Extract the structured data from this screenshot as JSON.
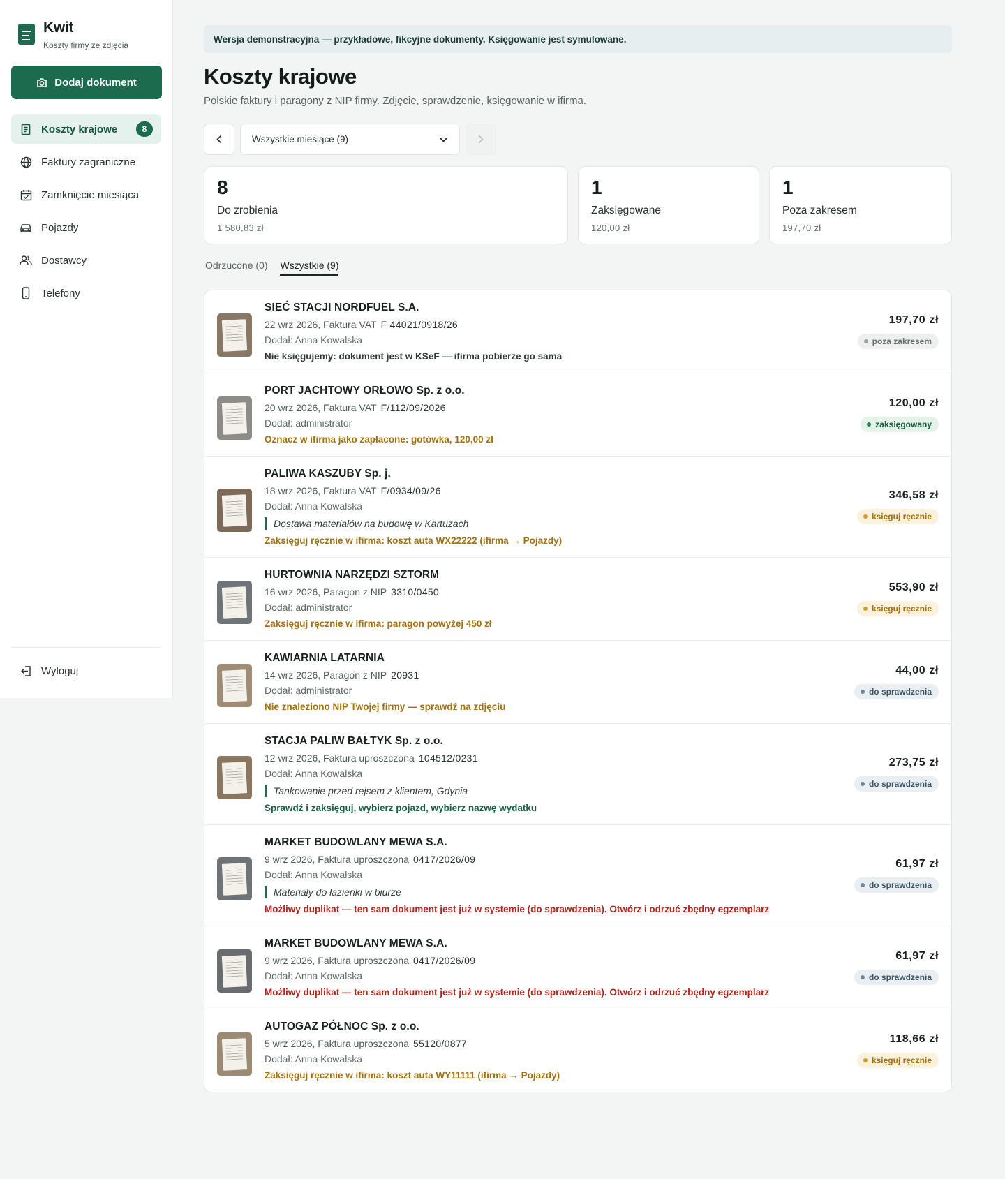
{
  "app": {
    "name": "Kwit",
    "tagline": "Koszty firmy ze zdjęcia"
  },
  "sidebar": {
    "add_button": "Dodaj dokument",
    "items": [
      {
        "label": "Koszty krajowe",
        "icon": "receipt-icon",
        "badge": "8",
        "active": true
      },
      {
        "label": "Faktury zagraniczne",
        "icon": "globe-icon"
      },
      {
        "label": "Zamknięcie miesiąca",
        "icon": "calendar-check-icon"
      },
      {
        "label": "Pojazdy",
        "icon": "car-icon"
      },
      {
        "label": "Dostawcy",
        "icon": "users-icon"
      },
      {
        "label": "Telefony",
        "icon": "phone-icon"
      }
    ],
    "logout": "Wyloguj"
  },
  "banner": "Wersja demonstracyjna — przykładowe, fikcyjne dokumenty. Księgowanie jest symulowane.",
  "header": {
    "title": "Koszty krajowe",
    "subtitle": "Polskie faktury i paragony z NIP firmy. Zdjęcie, sprawdzenie, księgowanie w ifirma."
  },
  "month_select": {
    "value": "Wszystkie miesiące (9)"
  },
  "stats": [
    {
      "number": "8",
      "label": "Do zrobienia",
      "amount": "1 580,83 zł"
    },
    {
      "number": "1",
      "label": "Zaksięgowane",
      "amount": "120,00 zł"
    },
    {
      "number": "1",
      "label": "Poza zakresem",
      "amount": "197,70 zł"
    }
  ],
  "tabs": [
    {
      "label": "Odrzucone (0)",
      "active": false
    },
    {
      "label": "Wszystkie (9)",
      "active": true
    }
  ],
  "colors": {
    "accent": "#1d6b4f",
    "amber": "#a4700a",
    "red": "#b3261e"
  },
  "documents": [
    {
      "vendor": "SIEĆ STACJI NORDFUEL S.A.",
      "meta": "22 wrz 2026, Faktura VAT",
      "doc_no": "F 44021/0918/26",
      "added_by": "Dodał: Anna Kowalska",
      "note": "",
      "hint": "Nie księgujemy: dokument jest w KSeF — ifirma pobierze go sama",
      "hint_type": "grey",
      "amount": "197,70 zł",
      "status": "poza zakresem",
      "status_type": "out",
      "thumb_color": "#8a7866"
    },
    {
      "vendor": "PORT JACHTOWY ORŁOWO Sp. z o.o.",
      "meta": "20 wrz 2026, Faktura VAT",
      "doc_no": "F/112/09/2026",
      "added_by": "Dodał: administrator",
      "note": "",
      "hint": "Oznacz w ifirma jako zapłacone: gotówka, 120,00 zł",
      "hint_type": "amber",
      "amount": "120,00 zł",
      "status": "zaksięgowany",
      "status_type": "done",
      "thumb_color": "#8e8c87"
    },
    {
      "vendor": "PALIWA KASZUBY Sp. j.",
      "meta": "18 wrz 2026, Faktura VAT",
      "doc_no": "F/0934/09/26",
      "added_by": "Dodał: Anna Kowalska",
      "note": "Dostawa materiałów na budowę w Kartuzach",
      "hint": "Zaksięguj ręcznie w ifirma: koszt auta WX22222 (ifirma → Pojazdy)",
      "hint_type": "amber",
      "amount": "346,58 zł",
      "status": "księguj ręcznie",
      "status_type": "manual",
      "thumb_color": "#7d6a58"
    },
    {
      "vendor": "HURTOWNIA NARZĘDZI SZTORM",
      "meta": "16 wrz 2026, Paragon z NIP",
      "doc_no": "3310/0450",
      "added_by": "Dodał: administrator",
      "note": "",
      "hint": "Zaksięguj ręcznie w ifirma: paragon powyżej 450 zł",
      "hint_type": "amber",
      "amount": "553,90 zł",
      "status": "księguj ręcznie",
      "status_type": "manual",
      "thumb_color": "#6f7479"
    },
    {
      "vendor": "KAWIARNIA LATARNIA",
      "meta": "14 wrz 2026, Paragon z NIP",
      "doc_no": "20931",
      "added_by": "Dodał: administrator",
      "note": "",
      "hint": "Nie znaleziono NIP Twojej firmy — sprawdź na zdjęciu",
      "hint_type": "amber",
      "amount": "44,00 zł",
      "status": "do sprawdzenia",
      "status_type": "check",
      "thumb_color": "#a08c74"
    },
    {
      "vendor": "STACJA PALIW BAŁTYK Sp. z o.o.",
      "meta": "12 wrz 2026, Faktura uproszczona",
      "doc_no": "104512/0231",
      "added_by": "Dodał: Anna Kowalska",
      "note": "Tankowanie przed rejsem z klientem, Gdynia",
      "hint": "Sprawdź i zaksięguj, wybierz pojazd, wybierz nazwę wydatku",
      "hint_type": "green",
      "amount": "273,75 zł",
      "status": "do sprawdzenia",
      "status_type": "check",
      "thumb_color": "#8b7660"
    },
    {
      "vendor": "MARKET BUDOWLANY MEWA S.A.",
      "meta": "9 wrz 2026, Faktura uproszczona",
      "doc_no": "0417/2026/09",
      "added_by": "Dodał: Anna Kowalska",
      "note": "Materiały do łazienki w biurze",
      "hint": "Możliwy duplikat — ten sam dokument jest już w systemie (do sprawdzenia). Otwórz i odrzuć zbędny egzemplarz",
      "hint_type": "red",
      "amount": "61,97 zł",
      "status": "do sprawdzenia",
      "status_type": "check",
      "thumb_color": "#6e7378"
    },
    {
      "vendor": "MARKET BUDOWLANY MEWA S.A.",
      "meta": "9 wrz 2026, Faktura uproszczona",
      "doc_no": "0417/2026/09",
      "added_by": "Dodał: Anna Kowalska",
      "note": "",
      "hint": "Możliwy duplikat — ten sam dokument jest już w systemie (do sprawdzenia). Otwórz i odrzuć zbędny egzemplarz",
      "hint_type": "red",
      "amount": "61,97 zł",
      "status": "do sprawdzenia",
      "status_type": "check",
      "thumb_color": "#6a6d70"
    },
    {
      "vendor": "AUTOGAZ PÓŁNOC Sp. z o.o.",
      "meta": "5 wrz 2026, Faktura uproszczona",
      "doc_no": "55120/0877",
      "added_by": "Dodał: Anna Kowalska",
      "note": "",
      "hint": "Zaksięguj ręcznie w ifirma: koszt auta WY11111 (ifirma → Pojazdy)",
      "hint_type": "amber",
      "amount": "118,66 zł",
      "status": "księguj ręcznie",
      "status_type": "manual",
      "thumb_color": "#9c8a73"
    }
  ]
}
